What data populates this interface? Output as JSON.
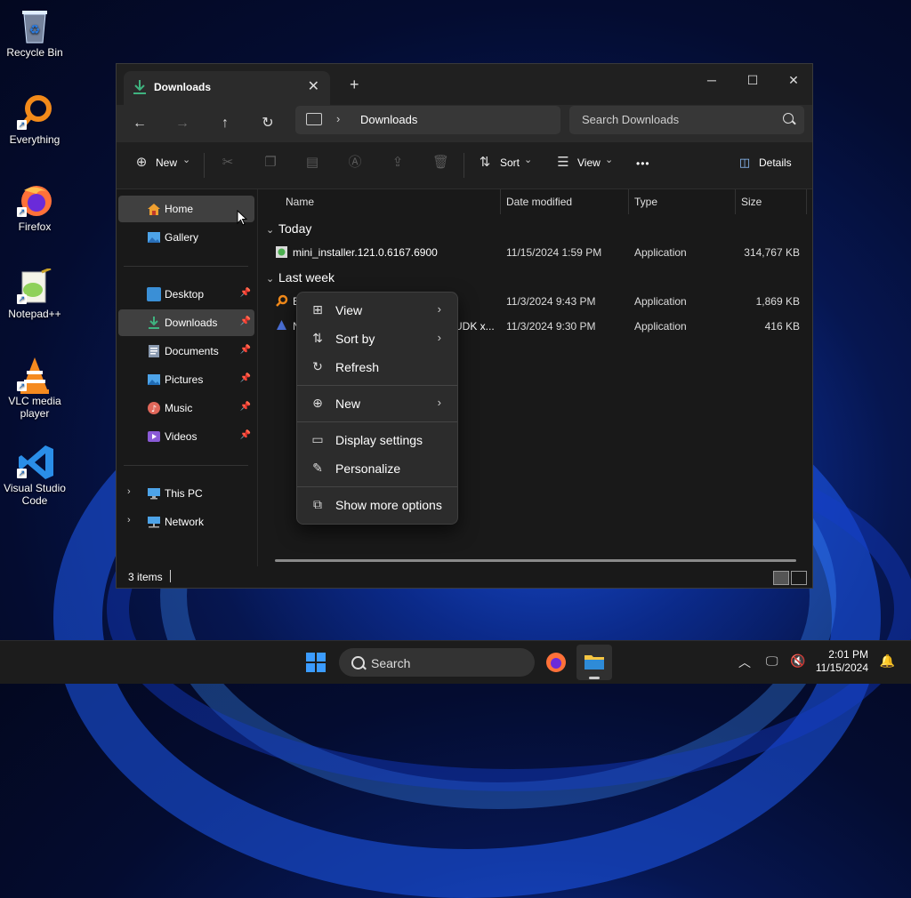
{
  "desktop": {
    "icons": [
      {
        "label": "Recycle Bin",
        "icon": "recycle-bin-icon"
      },
      {
        "label": "Everything",
        "icon": "everything-search-icon"
      },
      {
        "label": "Firefox",
        "icon": "firefox-icon"
      },
      {
        "label": "Notepad++",
        "icon": "notepad-plus-plus-icon"
      },
      {
        "label": "VLC media player",
        "icon": "vlc-icon"
      },
      {
        "label": "Visual Studio Code",
        "icon": "vscode-icon"
      }
    ]
  },
  "window": {
    "tab_title": "Downloads",
    "tab_close": "✕",
    "new_tab": "+",
    "minimize": "─",
    "maximize": "☐",
    "close": "✕"
  },
  "navbar": {
    "back": "←",
    "forward": "→",
    "up": "↑",
    "refresh": "↻",
    "breadcrumb_sep": "›",
    "breadcrumb": "Downloads",
    "search_placeholder": "Search Downloads"
  },
  "commandbar": {
    "new_label": "New",
    "sort_label": "Sort",
    "view_label": "View",
    "more": "•••",
    "details_label": "Details",
    "dropdown_glyph": "⌄"
  },
  "sidebar": {
    "home": "Home",
    "gallery": "Gallery",
    "quick_access": [
      {
        "label": "Desktop",
        "color": "#3a8fd6"
      },
      {
        "label": "Downloads",
        "color": "#3fb37f"
      },
      {
        "label": "Documents",
        "color": "#7a8aa0"
      },
      {
        "label": "Pictures",
        "color": "#4da3e8"
      },
      {
        "label": "Music",
        "color": "#e0675a"
      },
      {
        "label": "Videos",
        "color": "#8a5ad6"
      }
    ],
    "this_pc": "This PC",
    "network": "Network",
    "pin": "📌",
    "expand": "›"
  },
  "columns": {
    "name": "Name",
    "date": "Date modified",
    "type": "Type",
    "size": "Size"
  },
  "groups": {
    "today": "Today",
    "last_week": "Last week",
    "chevron": "⌄"
  },
  "files": [
    {
      "name": "mini_installer.121.0.6167.6900",
      "date": "11/15/2024 1:59 PM",
      "type": "Application",
      "size": "314,767 KB"
    },
    {
      "name": "E",
      "date": "11/3/2024 9:43 PM",
      "type": "Application",
      "size": "1,869 KB"
    },
    {
      "name": "N",
      "name_tail": "UDK x...",
      "date": "11/3/2024 9:30 PM",
      "type": "Application",
      "size": "416 KB"
    }
  ],
  "context_menu": {
    "view": "View",
    "sort_by": "Sort by",
    "refresh": "Refresh",
    "new": "New",
    "display_settings": "Display settings",
    "personalize": "Personalize",
    "show_more": "Show more options",
    "submenu_arrow": "›"
  },
  "statusbar": {
    "count": "3 items"
  },
  "taskbar": {
    "search": "Search",
    "tray_chevron": "︿",
    "time": "2:01 PM",
    "date": "11/15/2024",
    "bell": "🔔"
  }
}
